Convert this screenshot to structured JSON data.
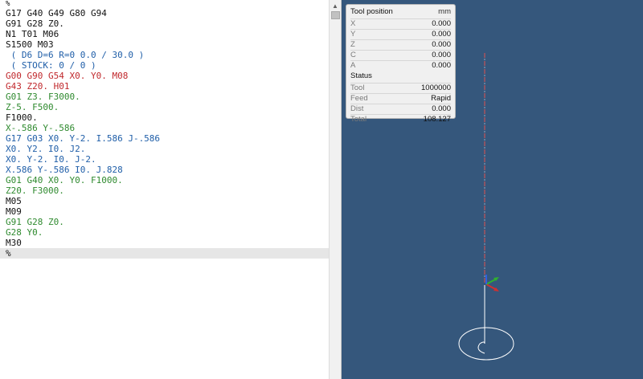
{
  "editor": {
    "lines": [
      {
        "text": "%",
        "color": "black"
      },
      {
        "text": "G17 G40 G49 G80 G94",
        "color": "black"
      },
      {
        "text": "G91 G28 Z0.",
        "color": "black"
      },
      {
        "text": "N1 T01 M06",
        "color": "black"
      },
      {
        "text": "S1500 M03",
        "color": "black"
      },
      {
        "text": " ( D6 D=6 R=0 0.0 / 30.0 )",
        "color": "blue"
      },
      {
        "text": " ( STOCK: 0 / 0 )",
        "color": "blue"
      },
      {
        "text": "G00 G90 G54 X0. Y0. M08",
        "color": "red"
      },
      {
        "text": "G43 Z20. H01",
        "color": "red"
      },
      {
        "text": "G01 Z3. F3000.",
        "color": "green"
      },
      {
        "text": "Z-5. F500.",
        "color": "green"
      },
      {
        "text": "F1000.",
        "color": "black"
      },
      {
        "text": "X-.586 Y-.586",
        "color": "green"
      },
      {
        "text": "G17 G03 X0. Y-2. I.586 J-.586",
        "color": "blue"
      },
      {
        "text": "X0. Y2. I0. J2.",
        "color": "blue"
      },
      {
        "text": "X0. Y-2. I0. J-2.",
        "color": "blue"
      },
      {
        "text": "X.586 Y-.586 I0. J.828",
        "color": "blue"
      },
      {
        "text": "G01 G40 X0. Y0. F1000.",
        "color": "green"
      },
      {
        "text": "Z20. F3000.",
        "color": "green"
      },
      {
        "text": "M05",
        "color": "black"
      },
      {
        "text": "M09",
        "color": "black"
      },
      {
        "text": "G91 G28 Z0.",
        "color": "green"
      },
      {
        "text": "G28 Y0.",
        "color": "green"
      },
      {
        "text": "M30",
        "color": "black"
      },
      {
        "text": "%",
        "color": "black",
        "highlighted": true
      }
    ]
  },
  "scrollbar": {
    "up_icon": "chevron-up-icon"
  },
  "panel": {
    "tool_position": {
      "title": "Tool position",
      "unit": "mm",
      "rows": [
        {
          "label": "X",
          "value": "0.000"
        },
        {
          "label": "Y",
          "value": "0.000"
        },
        {
          "label": "Z",
          "value": "0.000"
        },
        {
          "label": "C",
          "value": "0.000"
        },
        {
          "label": "A",
          "value": "0.000"
        }
      ]
    },
    "status": {
      "title": "Status",
      "rows": [
        {
          "label": "Tool",
          "value": "1000000"
        },
        {
          "label": "Feed",
          "value": "Rapid"
        },
        {
          "label": "Dist",
          "value": "0.000"
        },
        {
          "label": "Total",
          "value": "108.127"
        }
      ]
    }
  },
  "viewport": {
    "background": "#35577c",
    "colors": {
      "rapid": "#e05050",
      "feed": "#ffffff",
      "axis_x": "#d03030",
      "axis_y": "#30b030",
      "axis_z": "#3060e0"
    }
  }
}
